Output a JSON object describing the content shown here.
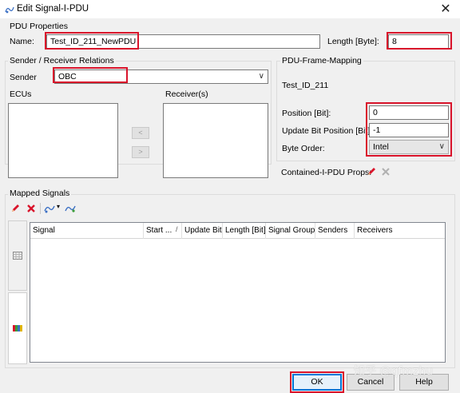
{
  "window": {
    "title": "Edit Signal-I-PDU"
  },
  "pdu_properties": {
    "group_title": "PDU Properties",
    "name_label": "Name:",
    "name_value": "Test_ID_211_NewPDU",
    "length_label": "Length [Byte]:",
    "length_value": "8"
  },
  "sender_receiver": {
    "group_title": "Sender / Receiver Relations",
    "sender_label": "Sender",
    "sender_value": "OBC",
    "ecus_label": "ECUs",
    "receivers_label": "Receiver(s)",
    "add_arrow": "<",
    "remove_arrow": ">"
  },
  "frame_mapping": {
    "group_title": "PDU-Frame-Mapping",
    "frame_name": "Test_ID_211",
    "position_label": "Position [Bit]:",
    "position_value": "0",
    "update_bit_label": "Update Bit Position [Bit]:",
    "update_bit_value": "-1",
    "byte_order_label": "Byte Order:",
    "byte_order_value": "Intel"
  },
  "contained": {
    "label": "Contained-I-PDU Props:"
  },
  "mapped_signals": {
    "group_title": "Mapped Signals",
    "columns": [
      "Signal",
      "Start ...",
      "Update Bit",
      "Length [Bit]",
      "Signal Group",
      "Senders",
      "Receivers"
    ]
  },
  "buttons": {
    "ok": "OK",
    "cancel": "Cancel",
    "help": "Help"
  },
  "watermark": "知乎 @qfmzhu",
  "icons": {
    "window": "signal-pdu-icon",
    "edit": "pencil-icon",
    "delete": "red-x-icon",
    "add_signal": "add-signal-icon",
    "replace_signal": "replace-signal-icon",
    "toggle": "grid-toggle-icon",
    "color": "color-bar-icon"
  },
  "colors": {
    "highlight": "#d9142b",
    "default_button": "#0078d7"
  }
}
